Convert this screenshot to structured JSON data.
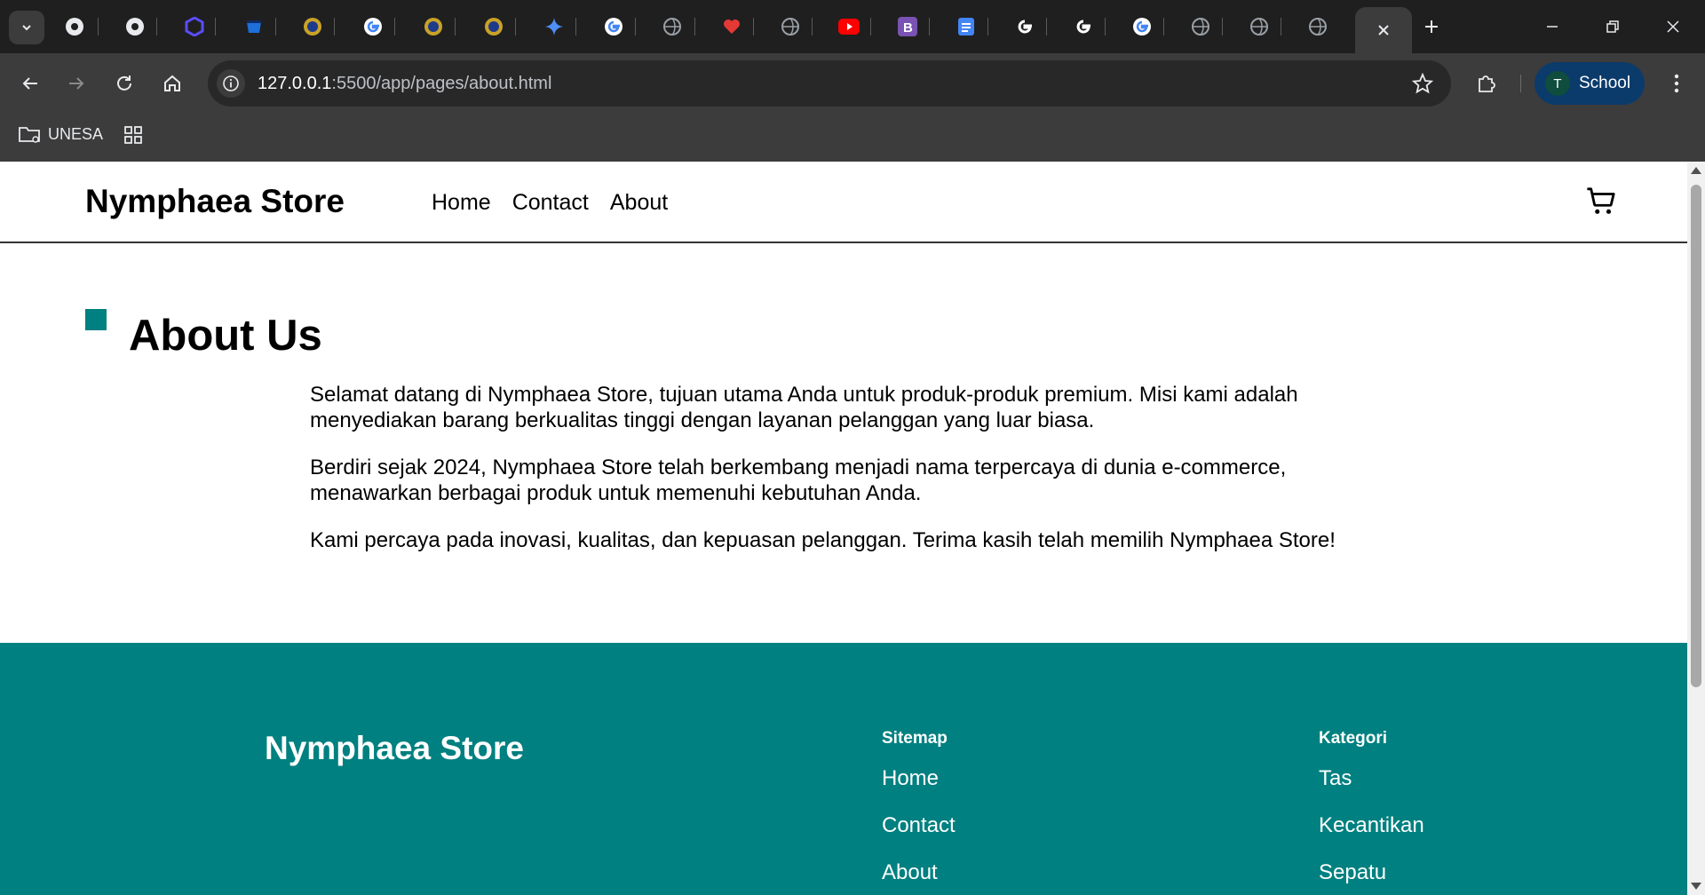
{
  "browser": {
    "url_host": "127.0.0.1",
    "url_path": ":5500/app/pages/about.html",
    "profile_initial": "T",
    "profile_name": "School",
    "bookmark_label": "UNESA"
  },
  "colors": {
    "accent": "#008080",
    "chrome_dark": "#1f1f1f",
    "chrome_toolbar": "#3c3c3c"
  },
  "header": {
    "brand": "Nymphaea Store",
    "nav": [
      "Home",
      "Contact",
      "About"
    ]
  },
  "about": {
    "title": "About Us",
    "paragraphs": [
      "Selamat datang di Nymphaea Store, tujuan utama Anda untuk produk-produk premium. Misi kami adalah menyediakan barang berkualitas tinggi dengan layanan pelanggan yang luar biasa.",
      "Berdiri sejak 2024, Nymphaea Store telah berkembang menjadi nama terpercaya di dunia e-commerce, menawarkan berbagai produk untuk memenuhi kebutuhan Anda.",
      "Kami percaya pada inovasi, kualitas, dan kepuasan pelanggan. Terima kasih telah memilih Nymphaea Store!"
    ]
  },
  "footer": {
    "brand": "Nymphaea Store",
    "sitemap": {
      "heading": "Sitemap",
      "links": [
        "Home",
        "Contact",
        "About"
      ]
    },
    "kategori": {
      "heading": "Kategori",
      "links": [
        "Tas",
        "Kecantikan",
        "Sepatu"
      ]
    }
  }
}
